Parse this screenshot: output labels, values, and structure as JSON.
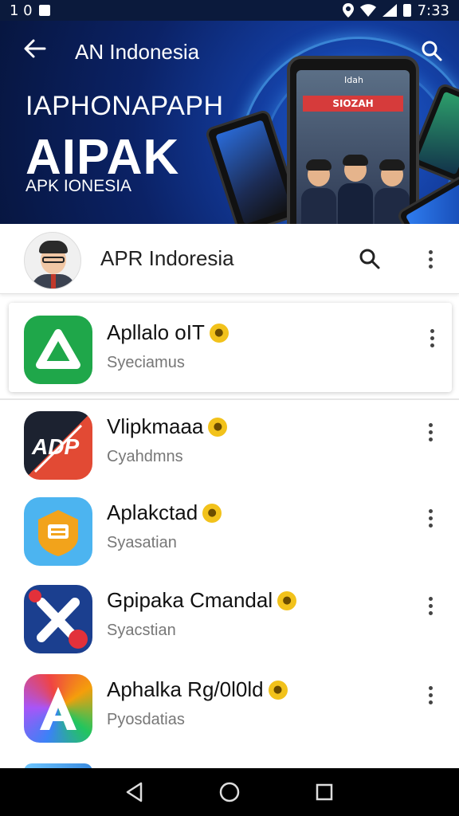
{
  "status_bar": {
    "left_text": "1 0",
    "time": "7:33"
  },
  "hero": {
    "title": "AN Indonesia",
    "headline_top": "IAPHONAPAPH",
    "headline_big": "AIPAK",
    "subtitle": "APK IONESIA",
    "phone_text_top": "Idah",
    "phone_banner_text": "SIOZAH"
  },
  "header": {
    "title": "APR Indoresia"
  },
  "apps": [
    {
      "title": "Apllalo oIT",
      "subtitle": "Syeciamus",
      "icon": "drive-triangle-icon",
      "color": "#1fa74a"
    },
    {
      "title": "Vlipkmaaa",
      "subtitle": "Cyahdmns",
      "icon": "adp-logo-icon",
      "color": "#e24a34"
    },
    {
      "title": "Aplakctad",
      "subtitle": "Syasatian",
      "icon": "shield-document-icon",
      "color": "#f2a31b"
    },
    {
      "title": "Gpipaka Cmandal",
      "subtitle": "Syacstian",
      "icon": "x-logo-icon",
      "color": "#1b3f8f"
    },
    {
      "title": "Aphalka Rg/0l0ld",
      "subtitle": "Pyosdatias",
      "icon": "rainbow-a-icon",
      "color": "#3b82f6"
    }
  ],
  "colors": {
    "hero_bg": "#0b2266",
    "badge": "#f2c21b",
    "nav_bg": "#000000"
  }
}
